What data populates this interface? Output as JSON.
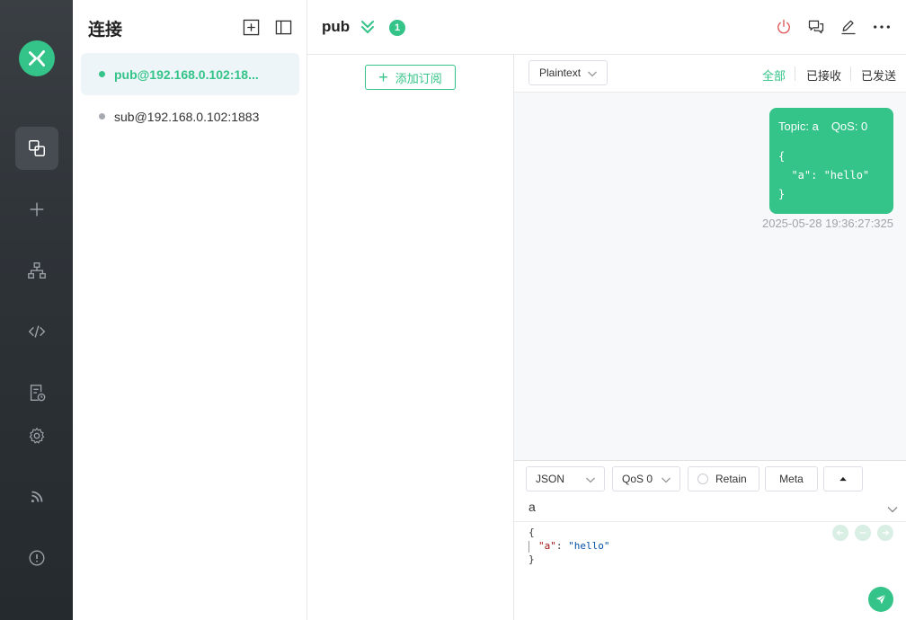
{
  "colors": {
    "accent": "#34c388",
    "nav_bg": "#2e3338",
    "danger": "#e05c5c"
  },
  "nav": {
    "items": [
      {
        "icon": "connections-icon",
        "active": true
      },
      {
        "icon": "plus-icon",
        "active": false
      },
      {
        "icon": "topology-icon",
        "active": false
      },
      {
        "icon": "code-icon",
        "active": false
      },
      {
        "icon": "log-icon",
        "active": false
      },
      {
        "icon": "gear-icon",
        "active": false
      },
      {
        "icon": "rss-icon",
        "active": false
      },
      {
        "icon": "info-icon",
        "active": false
      }
    ]
  },
  "connections": {
    "title": "连接",
    "items": [
      {
        "label": "pub@192.168.0.102:18...",
        "active": true,
        "status": "connected"
      },
      {
        "label": "sub@192.168.0.102:1883",
        "active": false,
        "status": "disconnected"
      }
    ]
  },
  "header": {
    "name": "pub",
    "badge": "1"
  },
  "subscriptions": {
    "add_label": "添加订阅"
  },
  "messages": {
    "format": "Plaintext",
    "filters": [
      "全部",
      "已接收",
      "已发送"
    ],
    "items": [
      {
        "topic_label": "Topic: a",
        "qos_label": "QoS: 0",
        "payload": "{\n  \"a\": \"hello\"\n}",
        "time": "2025-05-28 19:36:27:325"
      }
    ]
  },
  "publish": {
    "payload_format": "JSON",
    "qos": "QoS 0",
    "retain_label": "Retain",
    "meta_label": "Meta",
    "topic": "a",
    "payload_lines": {
      "open": "{",
      "key": "\"a\"",
      "colon": ": ",
      "value": "\"hello\"",
      "close": "}"
    }
  }
}
